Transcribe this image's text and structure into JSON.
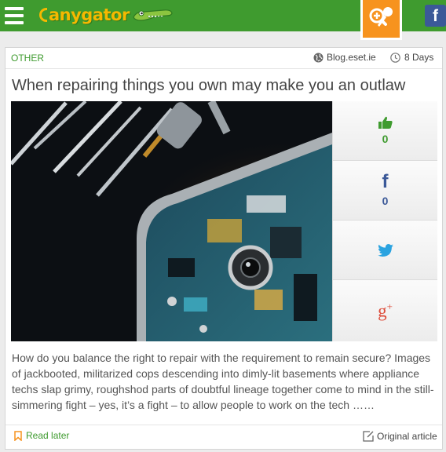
{
  "header": {
    "logo_text": "anygator",
    "fb_letter": "f",
    "brand_green": "#3f9b2f",
    "brand_yellow": "#f5b800",
    "accent_orange": "#f7931e"
  },
  "article": {
    "category": "OTHER",
    "source": "Blog.eset.ie",
    "age": "8 Days",
    "title": "When repairing things you own may make you an outlaw",
    "excerpt": "How do you balance the right to repair with the requirement to remain secure? Images of jackbooted, militarized cops descending into dimly-lit basements where appliance techs slap grimy, roughshod parts of doubtful lineage together come to mind in the still-simmering fight – yes, it’s a fight – to allow people to work on the tech ……"
  },
  "share": {
    "likes": "0",
    "facebook_letter": "f",
    "facebook_count": "0",
    "gplus_letter": "g",
    "gplus_sup": "+"
  },
  "footer": {
    "read_later": "Read later",
    "original": "Original article"
  }
}
